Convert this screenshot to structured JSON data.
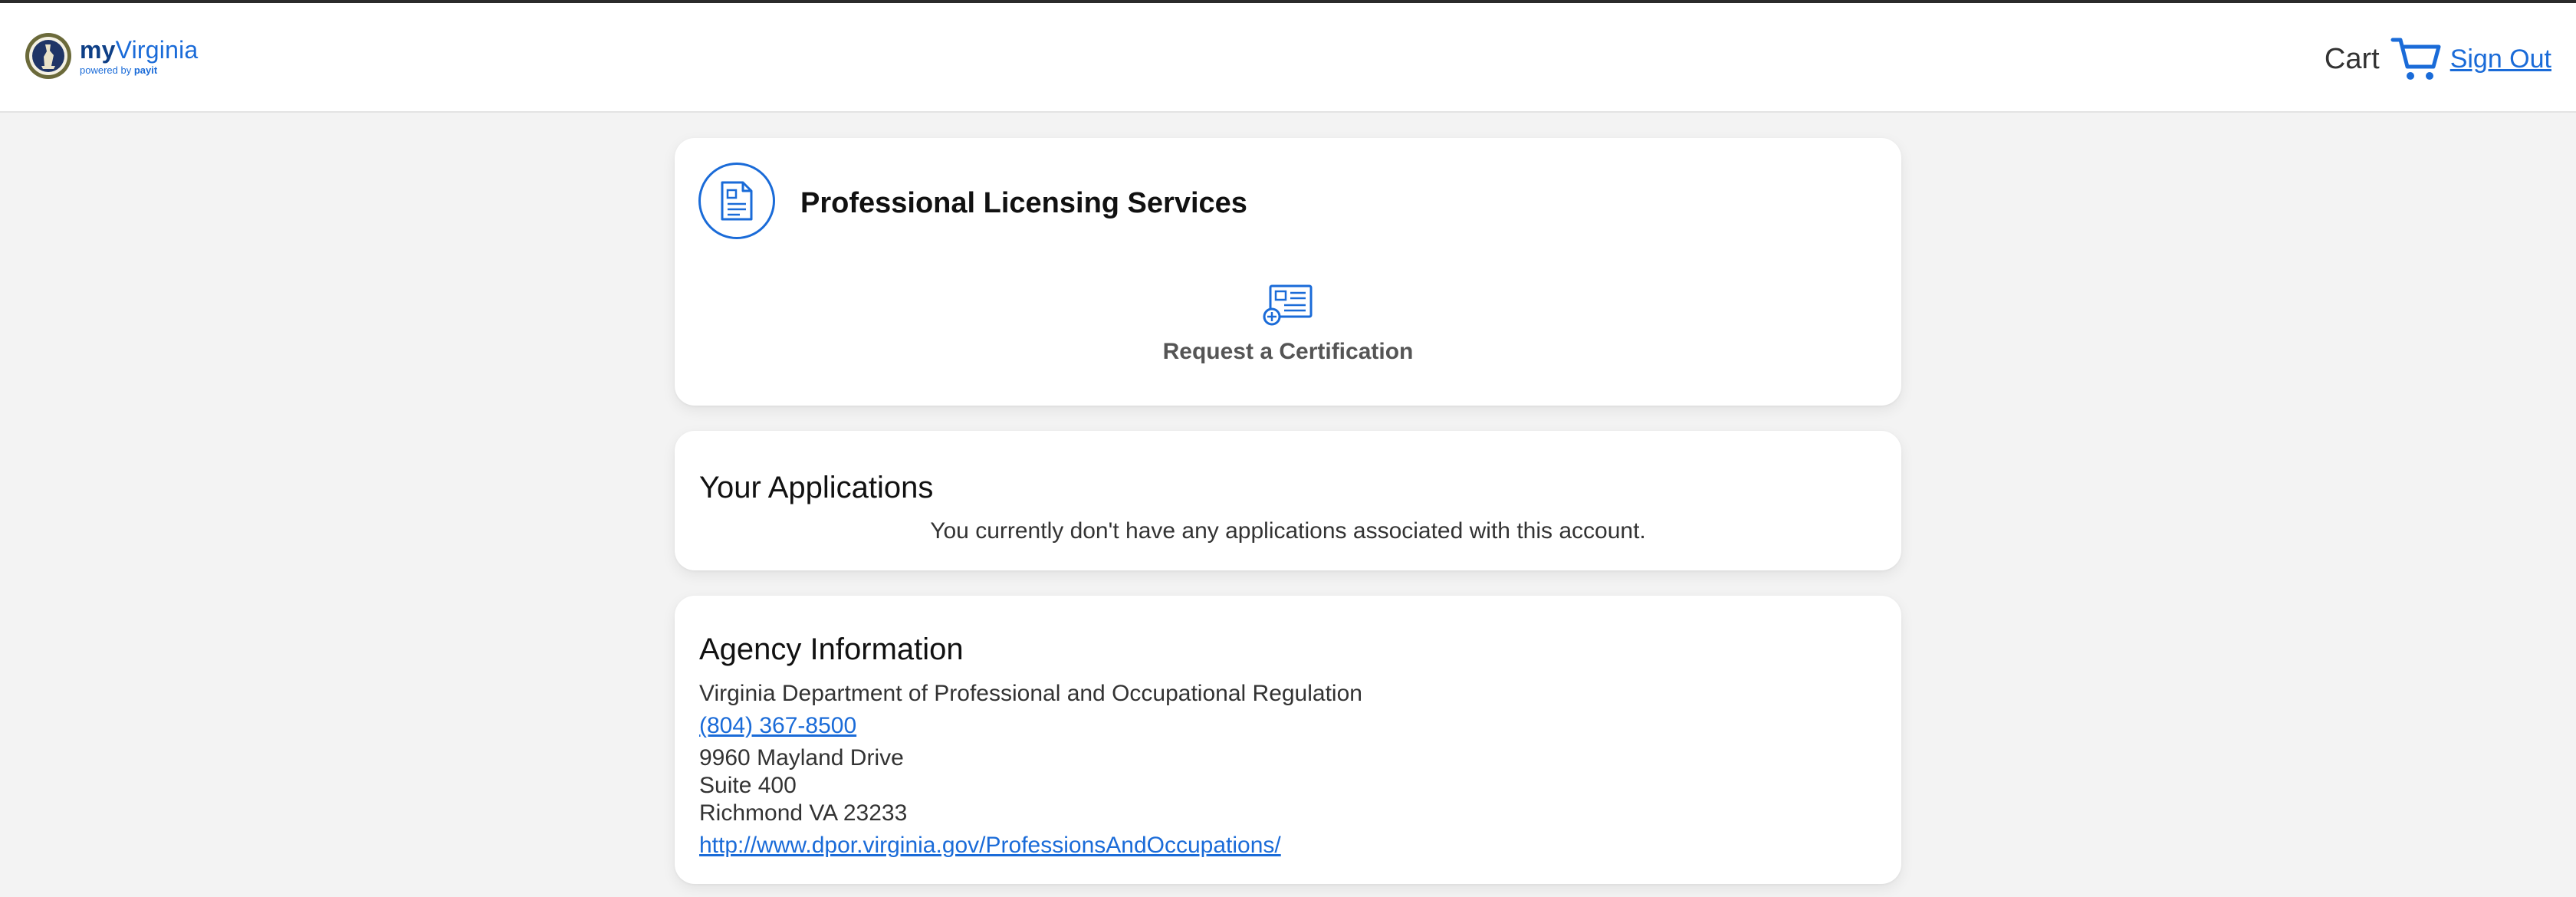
{
  "header": {
    "logo": {
      "brand_my": "my",
      "brand_name": "Virginia",
      "powered_prefix": "powered by",
      "powered_brand": "payit"
    },
    "cart_label": "Cart",
    "sign_out_label": "Sign Out"
  },
  "services_card": {
    "icon": "document-icon",
    "title": "Professional Licensing Services",
    "action": {
      "icon": "certificate-add-icon",
      "label": "Request a Certification"
    }
  },
  "applications_card": {
    "heading": "Your Applications",
    "empty_message": "You currently don't have any applications associated with this account."
  },
  "agency_card": {
    "heading": "Agency Information",
    "name": "Virginia Department of Professional and Occupational Regulation",
    "phone": "(804) 367-8500",
    "address_line1": "9960 Mayland Drive",
    "address_line2": "Suite 400",
    "city_state_zip": "Richmond VA 23233",
    "website": "http://www.dpor.virginia.gov/ProfessionsAndOccupations/"
  },
  "colors": {
    "accent": "#1a6bd8",
    "background": "#f3f3f3",
    "card": "#ffffff"
  }
}
